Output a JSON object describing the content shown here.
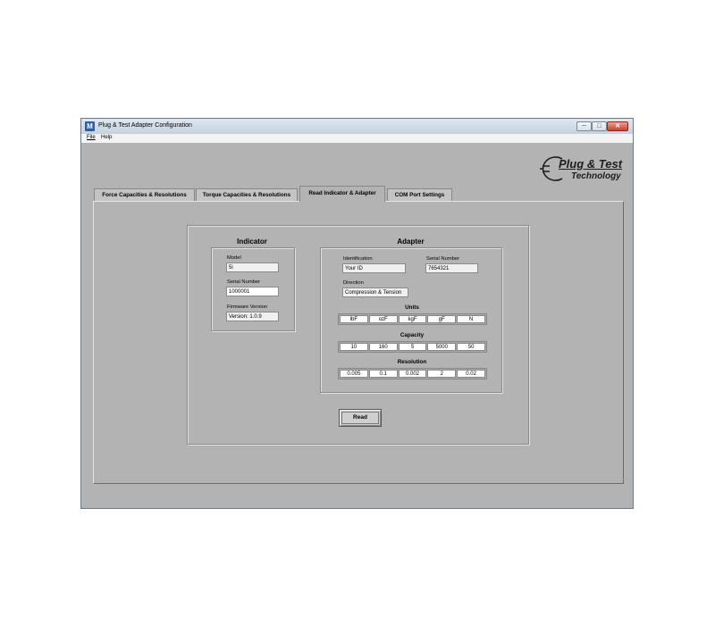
{
  "window": {
    "title": "Plug & Test Adapter Configuration",
    "app_icon": "M",
    "controls": {
      "minimize": "─",
      "maximize": "□",
      "close": "✕"
    }
  },
  "menu": {
    "file": "File",
    "help": "Help"
  },
  "logo": {
    "line1": "Plug & Test",
    "line2": "Technology"
  },
  "tabs": [
    {
      "label": "Force Capacities & Resolutions",
      "active": false
    },
    {
      "label": "Torque Capacities & Resolutions",
      "active": false
    },
    {
      "label": "Read Indicator & Adapter",
      "active": true
    },
    {
      "label": "COM Port Settings",
      "active": false
    }
  ],
  "indicator": {
    "title": "Indicator",
    "model_label": "Model",
    "model_value": "5i",
    "serial_label": "Serial Number",
    "serial_value": "1000001",
    "firmware_label": "Firmware Version",
    "firmware_value": "Version: 1.0.9"
  },
  "adapter": {
    "title": "Adapter",
    "id_label": "Identification",
    "id_value": "Your ID",
    "serial_label": "Serial Number",
    "serial_value": "7654321",
    "direction_label": "Direction",
    "direction_value": "Compression & Tension",
    "units_title": "Units",
    "units": [
      "lbF",
      "ozF",
      "kgF",
      "gF",
      "N"
    ],
    "capacity_title": "Capacity",
    "capacity": [
      "10",
      "160",
      "5",
      "5000",
      "50"
    ],
    "resolution_title": "Resolution",
    "resolution": [
      "0.005",
      "0.1",
      "0.002",
      "2",
      "0.02"
    ]
  },
  "read_button": "Read"
}
